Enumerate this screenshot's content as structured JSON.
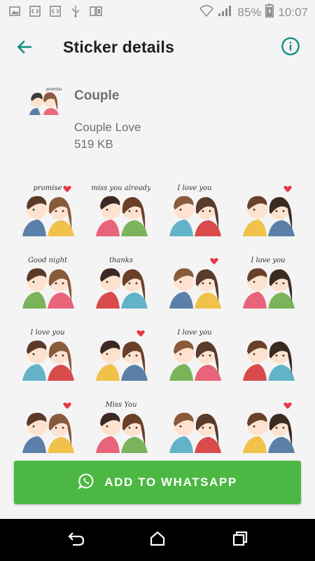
{
  "status_bar": {
    "battery": "85%",
    "time": "10:07",
    "icons_left": [
      "image-icon",
      "code-icon",
      "code-icon",
      "usb-icon",
      "sim-icon"
    ],
    "icons_right": [
      "wifi-icon",
      "signal-icon",
      "battery-charging-icon"
    ]
  },
  "toolbar": {
    "title": "Sticker details",
    "back_icon": "arrow-left-icon",
    "info_icon": "info-icon",
    "accent": "#128c7e"
  },
  "pack": {
    "name": "Couple",
    "publisher": "Couple Love",
    "size": "519 KB"
  },
  "stickers": [
    {
      "text": "promise"
    },
    {
      "text": "miss you already"
    },
    {
      "text": "I love you"
    },
    {
      "text": ""
    },
    {
      "text": "Good night"
    },
    {
      "text": "thanks"
    },
    {
      "text": ""
    },
    {
      "text": "I love you"
    },
    {
      "text": "I love you"
    },
    {
      "text": ""
    },
    {
      "text": "I love you"
    },
    {
      "text": ""
    },
    {
      "text": ""
    },
    {
      "text": "Miss You"
    },
    {
      "text": ""
    },
    {
      "text": ""
    }
  ],
  "add_button": {
    "label": "ADD TO WHATSAPP",
    "icon": "whatsapp-icon",
    "color": "#4cb843"
  },
  "nav_bar": {
    "icons": [
      "back-icon",
      "home-icon",
      "recents-icon"
    ]
  }
}
